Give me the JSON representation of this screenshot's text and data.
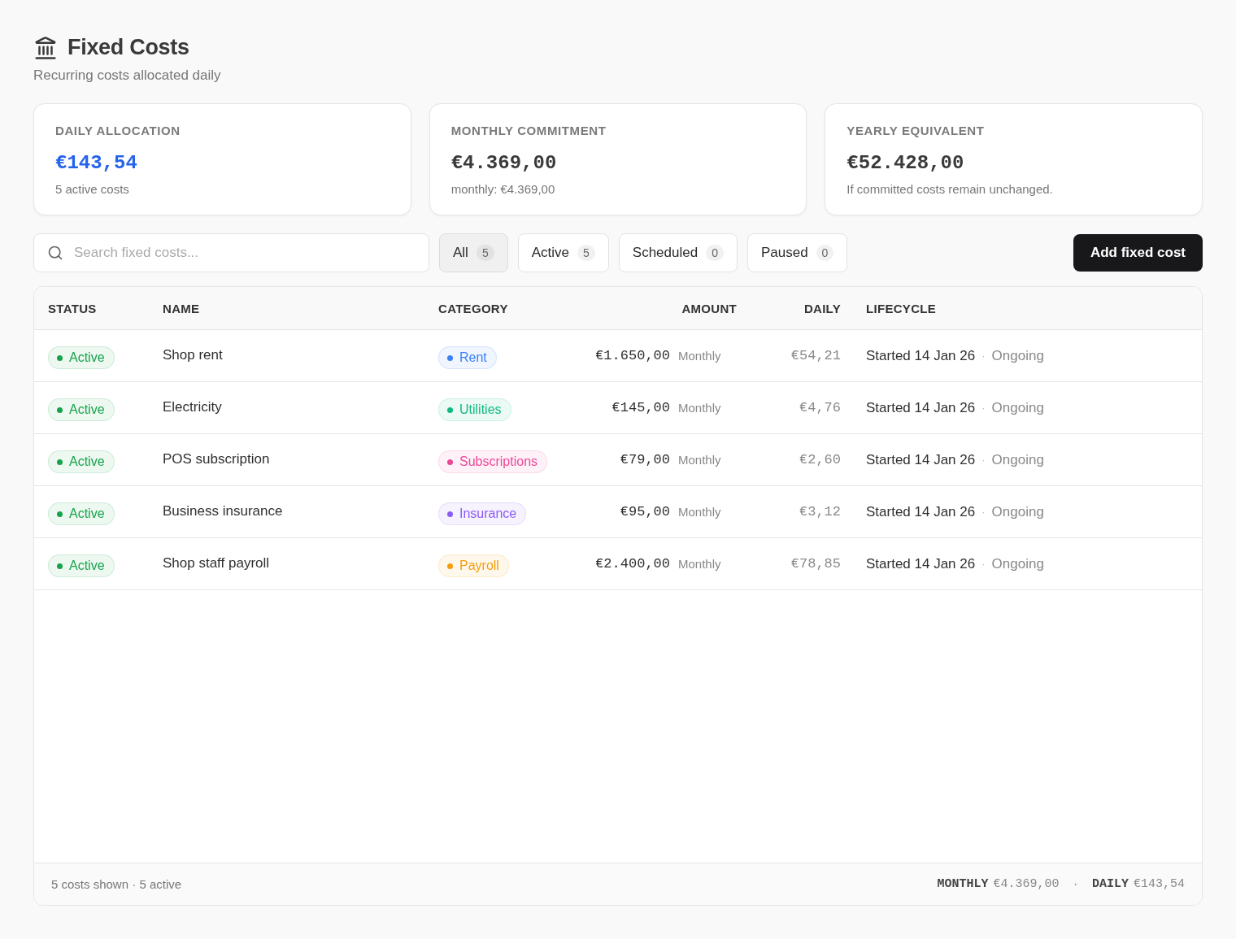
{
  "header": {
    "title": "Fixed Costs",
    "subtitle": "Recurring costs allocated daily"
  },
  "summary_cards": [
    {
      "label": "DAILY ALLOCATION",
      "value": "€143,54",
      "note": "5 active costs",
      "accent": true
    },
    {
      "label": "MONTHLY COMMITMENT",
      "value": "€4.369,00",
      "note": "monthly: €4.369,00",
      "accent": false
    },
    {
      "label": "YEARLY EQUIVALENT",
      "value": "€52.428,00",
      "note": "If committed costs remain unchanged.",
      "accent": false
    }
  ],
  "search": {
    "placeholder": "Search fixed costs..."
  },
  "filters": [
    {
      "label": "All",
      "count": "5",
      "selected": true
    },
    {
      "label": "Active",
      "count": "5",
      "selected": false
    },
    {
      "label": "Scheduled",
      "count": "0",
      "selected": false
    },
    {
      "label": "Paused",
      "count": "0",
      "selected": false
    }
  ],
  "add_button": "Add fixed cost",
  "table": {
    "columns": [
      "STATUS",
      "NAME",
      "CATEGORY",
      "AMOUNT",
      "DAILY",
      "LIFECYCLE"
    ],
    "rows": [
      {
        "status": {
          "label": "Active",
          "color": "#16a34a"
        },
        "name": "Shop rent",
        "category": {
          "label": "Rent",
          "color": "#3b82f6"
        },
        "amount": "€1.650,00",
        "frequency": "Monthly",
        "daily": "€54,21",
        "started": "Started 14 Jan 26",
        "separator": "·",
        "end": "Ongoing"
      },
      {
        "status": {
          "label": "Active",
          "color": "#16a34a"
        },
        "name": "Electricity",
        "category": {
          "label": "Utilities",
          "color": "#10b981"
        },
        "amount": "€145,00",
        "frequency": "Monthly",
        "daily": "€4,76",
        "started": "Started 14 Jan 26",
        "separator": "·",
        "end": "Ongoing"
      },
      {
        "status": {
          "label": "Active",
          "color": "#16a34a"
        },
        "name": "POS subscription",
        "category": {
          "label": "Subscriptions",
          "color": "#ec4899"
        },
        "amount": "€79,00",
        "frequency": "Monthly",
        "daily": "€2,60",
        "started": "Started 14 Jan 26",
        "separator": "·",
        "end": "Ongoing"
      },
      {
        "status": {
          "label": "Active",
          "color": "#16a34a"
        },
        "name": "Business insurance",
        "category": {
          "label": "Insurance",
          "color": "#8b5cf6"
        },
        "amount": "€95,00",
        "frequency": "Monthly",
        "daily": "€3,12",
        "started": "Started 14 Jan 26",
        "separator": "·",
        "end": "Ongoing"
      },
      {
        "status": {
          "label": "Active",
          "color": "#16a34a"
        },
        "name": "Shop staff payroll",
        "category": {
          "label": "Payroll",
          "color": "#f59e0b"
        },
        "amount": "€2.400,00",
        "frequency": "Monthly",
        "daily": "€78,85",
        "started": "Started 14 Jan 26",
        "separator": "·",
        "end": "Ongoing"
      }
    ]
  },
  "footer": {
    "summary": "5 costs shown · 5 active",
    "totals": [
      {
        "label": "MONTHLY",
        "value": "€4.369,00"
      },
      {
        "label": "DAILY",
        "value": "€143,54"
      }
    ],
    "separator": "·"
  }
}
